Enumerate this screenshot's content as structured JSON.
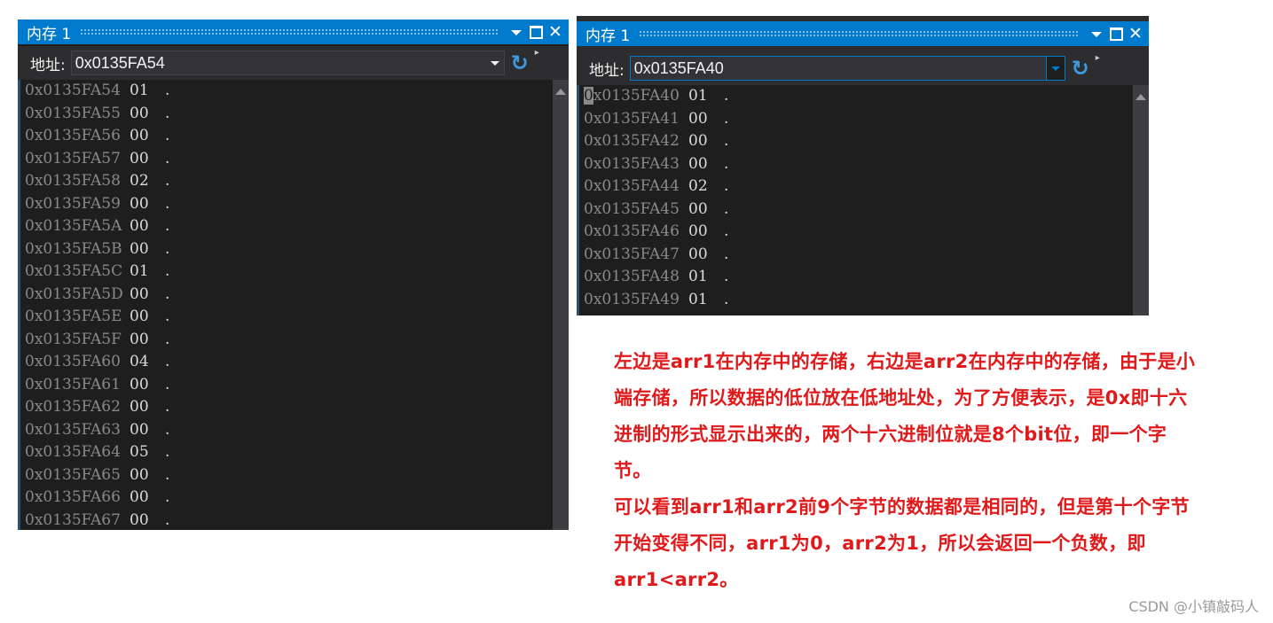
{
  "left_window": {
    "title": "内存 1",
    "address_label": "地址:",
    "address_value": "0x0135FA54",
    "rows": [
      {
        "addr": "0x0135FA54",
        "byte": "01",
        "char": "."
      },
      {
        "addr": "0x0135FA55",
        "byte": "00",
        "char": "."
      },
      {
        "addr": "0x0135FA56",
        "byte": "00",
        "char": "."
      },
      {
        "addr": "0x0135FA57",
        "byte": "00",
        "char": "."
      },
      {
        "addr": "0x0135FA58",
        "byte": "02",
        "char": "."
      },
      {
        "addr": "0x0135FA59",
        "byte": "00",
        "char": "."
      },
      {
        "addr": "0x0135FA5A",
        "byte": "00",
        "char": "."
      },
      {
        "addr": "0x0135FA5B",
        "byte": "00",
        "char": "."
      },
      {
        "addr": "0x0135FA5C",
        "byte": "01",
        "char": "."
      },
      {
        "addr": "0x0135FA5D",
        "byte": "00",
        "char": "."
      },
      {
        "addr": "0x0135FA5E",
        "byte": "00",
        "char": "."
      },
      {
        "addr": "0x0135FA5F",
        "byte": "00",
        "char": "."
      },
      {
        "addr": "0x0135FA60",
        "byte": "04",
        "char": "."
      },
      {
        "addr": "0x0135FA61",
        "byte": "00",
        "char": "."
      },
      {
        "addr": "0x0135FA62",
        "byte": "00",
        "char": "."
      },
      {
        "addr": "0x0135FA63",
        "byte": "00",
        "char": "."
      },
      {
        "addr": "0x0135FA64",
        "byte": "05",
        "char": "."
      },
      {
        "addr": "0x0135FA65",
        "byte": "00",
        "char": "."
      },
      {
        "addr": "0x0135FA66",
        "byte": "00",
        "char": "."
      },
      {
        "addr": "0x0135FA67",
        "byte": "00",
        "char": "."
      }
    ]
  },
  "right_window": {
    "title": "内存 1",
    "address_label": "地址:",
    "address_value": "0x0135FA40",
    "rows": [
      {
        "addr": "0x0135FA40",
        "byte": "01",
        "char": "."
      },
      {
        "addr": "0x0135FA41",
        "byte": "00",
        "char": "."
      },
      {
        "addr": "0x0135FA42",
        "byte": "00",
        "char": "."
      },
      {
        "addr": "0x0135FA43",
        "byte": "00",
        "char": "."
      },
      {
        "addr": "0x0135FA44",
        "byte": "02",
        "char": "."
      },
      {
        "addr": "0x0135FA45",
        "byte": "00",
        "char": "."
      },
      {
        "addr": "0x0135FA46",
        "byte": "00",
        "char": "."
      },
      {
        "addr": "0x0135FA47",
        "byte": "00",
        "char": "."
      },
      {
        "addr": "0x0135FA48",
        "byte": "01",
        "char": "."
      },
      {
        "addr": "0x0135FA49",
        "byte": "01",
        "char": "."
      }
    ]
  },
  "icons": {
    "dropdown": "chevron-down-icon",
    "maximize": "maximize-icon",
    "close": "close-icon",
    "refresh": "refresh-icon",
    "overflow": "toolbar-overflow-icon"
  },
  "annotation": {
    "paragraph1": "左边是arr1在内存中的存储，右边是arr2在内存中的存储，由于是小端存储，所以数据的低位放在低地址处，为了方便表示，是0x即十六进制的形式显示出来的，两个十六进制位就是8个bit位，即一个字节。",
    "paragraph2": "可以看到arr1和arr2前9个字节的数据都是相同的，但是第十个字节开始变得不同，arr1为0，arr2为1，所以会返回一个负数，即arr1<arr2。"
  },
  "watermark": "CSDN @小镇敲码人",
  "colors": {
    "titlebar": "#007acc",
    "editor_bg": "#1e1e1e",
    "annotation_text": "#e0191b"
  }
}
